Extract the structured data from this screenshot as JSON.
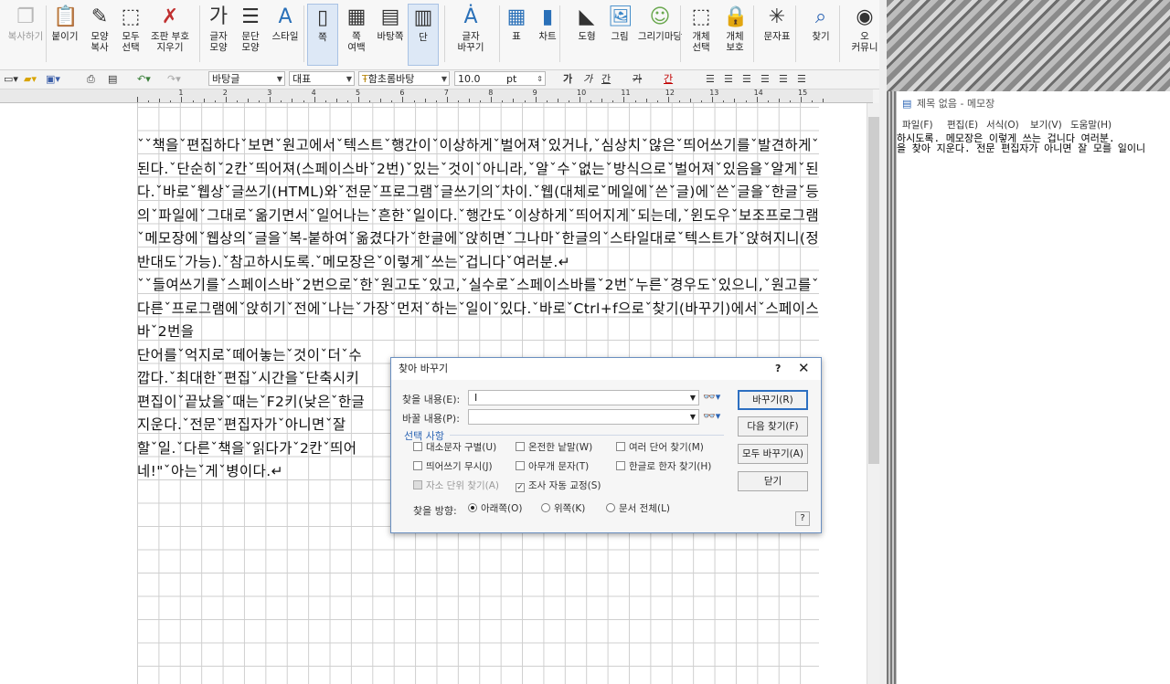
{
  "ribbon": {
    "buttons": [
      {
        "label": "복사하기",
        "icon": "copy-icon",
        "disabled": true
      },
      {
        "label": "붙이기",
        "icon": "paste-icon"
      },
      {
        "label": "모양\n복사",
        "icon": "format-painter-icon"
      },
      {
        "label": "모두\n선택",
        "icon": "select-all-icon"
      },
      {
        "label": "조판 부호\n지우기",
        "icon": "clear-codes-icon"
      },
      {
        "label": "글자\n모양",
        "icon": "char-shape-icon"
      },
      {
        "label": "문단\n모양",
        "icon": "para-shape-icon"
      },
      {
        "label": "스타일",
        "icon": "style-icon"
      },
      {
        "label": "쪽",
        "icon": "page-icon"
      },
      {
        "label": "쪽\n여백",
        "icon": "page-margin-icon"
      },
      {
        "label": "바탕쪽",
        "icon": "master-page-icon"
      },
      {
        "label": "단",
        "icon": "columns-icon"
      },
      {
        "label": "글자\n바꾸기",
        "icon": "char-replace-icon"
      },
      {
        "label": "표",
        "icon": "table-icon"
      },
      {
        "label": "차트",
        "icon": "chart-icon"
      },
      {
        "label": "도형",
        "icon": "shape-icon"
      },
      {
        "label": "그림",
        "icon": "picture-icon"
      },
      {
        "label": "그리기마당",
        "icon": "drawing-gallery-icon"
      },
      {
        "label": "개체\n선택",
        "icon": "object-select-icon"
      },
      {
        "label": "개체\n보호",
        "icon": "object-protect-icon"
      },
      {
        "label": "문자표",
        "icon": "symbol-icon"
      },
      {
        "label": "찾기",
        "icon": "find-icon"
      },
      {
        "label": "오\n커뮤니",
        "icon": "community-icon"
      }
    ]
  },
  "format_bar": {
    "style": "바탕글",
    "lang": "대표",
    "font": "함초롬바탕",
    "font_prefix": "Ŧ",
    "size": "10.0",
    "unit": "pt",
    "bold": "가",
    "italic": "가",
    "underline": "간",
    "strike": "가",
    "color_char": "간"
  },
  "ruler": {
    "numbers": [
      "1",
      "2",
      "3",
      "4",
      "5",
      "6",
      "7",
      "8",
      "9",
      "10",
      "11",
      "12",
      "13",
      "14",
      "15"
    ]
  },
  "document": {
    "paragraphs": [
      "ˇˇ책을ˇ편집하다ˇ보면ˇ원고에서ˇ텍스트ˇ행간이ˇ이상하게ˇ벌어져ˇ있거나,ˇ심상치ˇ않은ˇ띄어쓰기를ˇ발견하게ˇ된다.ˇ단순히ˇ2칸ˇ띄어져(스페이스바ˇ2번)ˇ있는ˇ것이ˇ아니라,ˇ알ˇ수ˇ없는ˇ방식으로ˇ벌어져ˇ있음을ˇ알게ˇ된다.ˇ바로ˇ웹상ˇ글쓰기(HTML)와ˇ전문ˇ프로그램ˇ글쓰기의ˇ차이.ˇ웹(대체로ˇ메일에ˇ쓴ˇ글)에ˇ쓴ˇ글을ˇ한글ˇ등의ˇ파일에ˇ그대로ˇ옮기면서ˇ일어나는ˇ흔한ˇ일이다.ˇ행간도ˇ이상하게ˇ띄어지게ˇ되는데,ˇ윈도우ˇ보조프로그램ˇ메모장에ˇ웹상의ˇ글을ˇ복-붙하여ˇ옮겼다가ˇ한글에ˇ앉히면ˇ그나마ˇ한글의ˇ스타일대로ˇ텍스트가ˇ앉혀지니(정반대도ˇ가능).ˇ참고하시도록.ˇ메모장은ˇ이렇게ˇ쓰는ˇ겁니다ˇ여러분.↵",
      "ˇˇ들여쓰기를ˇ스페이스바ˇ2번으로ˇ한ˇ원고도ˇ있고,ˇ실수로ˇ스페이스바를ˇ2번ˇ누른ˇ경우도ˇ있으니,ˇ원고를ˇ다른ˇ프로그램에ˇ앉히기ˇ전에ˇ나는ˇ가장ˇ먼저ˇ하는ˇ일이ˇ있다.ˇ바로ˇCtrl+f으로ˇ찾기(바꾸기)에서ˇ스페이스바ˇ2번을",
      "단어를ˇ억지로ˇ떼어놓는ˇ것이ˇ더ˇ수",
      "깝다.ˇ최대한ˇ편집ˇ시간을ˇ단축시키",
      "편집이ˇ끝났을ˇ때는ˇF2키(낮은ˇ한글",
      "지운다.ˇ전문ˇ편집자가ˇ아니면ˇ잘",
      "할ˇ일.ˇ다른ˇ책을ˇ읽다가ˇ2칸ˇ띄어",
      "네!\"ˇ아는ˇ게ˇ병이다.↵"
    ]
  },
  "notepad": {
    "title": "제목 없음 - 메모장",
    "menu": [
      "파일(F)",
      "편집(E)",
      "서식(O)",
      "보기(V)",
      "도움말(H)"
    ],
    "lines": [
      "하시도록. 메모장은 이렇게 쓰는 겁니다 여러분.",
      "을 찾아 지운다. 전문 편집자가 아니면 잘 모를 일이니"
    ]
  },
  "find_replace": {
    "title": "찾아 바꾸기",
    "help_q": "?",
    "find_label": "찾을 내용(E):",
    "find_value": "I",
    "replace_label": "바꿀 내용(P):",
    "replace_value": "",
    "options_header": "선택 사항",
    "options": [
      {
        "label": "대소문자 구별(U)",
        "checked": false
      },
      {
        "label": "온전한 낱말(W)",
        "checked": false
      },
      {
        "label": "여러 단어 찾기(M)",
        "checked": false
      },
      {
        "label": "띄어쓰기 무시(J)",
        "checked": false
      },
      {
        "label": "아무개 문자(T)",
        "checked": false
      },
      {
        "label": "한글로 한자 찾기(H)",
        "checked": false
      },
      {
        "label": "자소 단위 찾기(A)",
        "checked": false,
        "disabled": true
      },
      {
        "label": "조사 자동 교정(S)",
        "checked": true
      }
    ],
    "direction_label": "찾을 방향:",
    "directions": [
      {
        "label": "아래쪽(O)",
        "selected": true
      },
      {
        "label": "위쪽(K)",
        "selected": false
      },
      {
        "label": "문서 전체(L)",
        "selected": false
      }
    ],
    "buttons": {
      "replace": "바꾸기(R)",
      "find_next": "다음 찾기(F)",
      "replace_all": "모두 바꾸기(A)",
      "close": "닫기"
    }
  },
  "colors": {
    "dialog_border": "#6a8fc0",
    "primary_button_border": "#2d6fc1",
    "options_header": "#2b64b4"
  }
}
